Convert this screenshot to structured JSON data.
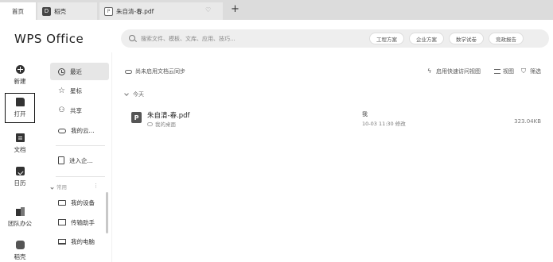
{
  "tabs": {
    "home": "首页",
    "doke": "稻壳",
    "pdf": "朱自清-春.pdf"
  },
  "header": {
    "logo": "WPS Office",
    "search_placeholder": "搜索文件、模板、文库、应用、技巧...",
    "chips": [
      "工程方案",
      "企业方案",
      "数学试卷",
      "竞政报告"
    ]
  },
  "rail": {
    "items": [
      {
        "label": "新建",
        "icon": "plus-circle-icon"
      },
      {
        "label": "打开",
        "icon": "folder-icon"
      },
      {
        "label": "文档",
        "icon": "document-icon"
      },
      {
        "label": "日历",
        "icon": "calendar-icon"
      },
      {
        "label": "团队办公",
        "icon": "team-icon"
      },
      {
        "label": "稻壳",
        "icon": "doke-icon"
      }
    ]
  },
  "nav": {
    "items": [
      {
        "label": "最近",
        "icon": "clock-icon"
      },
      {
        "label": "星标",
        "icon": "star-icon"
      },
      {
        "label": "共享",
        "icon": "share-icon"
      },
      {
        "label": "我的云...",
        "icon": "cloud-icon"
      },
      {
        "label": "进入企...",
        "icon": "enterprise-icon"
      }
    ],
    "group_label": "常用",
    "group_more": "⋮",
    "common": [
      {
        "label": "我的设备",
        "icon": "device-icon"
      },
      {
        "label": "传输助手",
        "icon": "transfer-icon"
      },
      {
        "label": "我的电脑",
        "icon": "computer-icon"
      }
    ]
  },
  "main": {
    "cloud_sync": "尚未启用文档云同步",
    "quick_view": "启用快速访问视图",
    "view": "视图",
    "filter": "筛选",
    "group_today": "今天",
    "files": [
      {
        "name": "朱自清-春.pdf",
        "location": "我的桌面",
        "owner": "我",
        "modified": "10-03 11:30 修改",
        "size": "323.04KB"
      }
    ]
  },
  "colors": {
    "tabbar_bg": "#dcdcdc",
    "active_nav_bg": "#e6e6e6",
    "search_bg": "#eeeeee"
  }
}
